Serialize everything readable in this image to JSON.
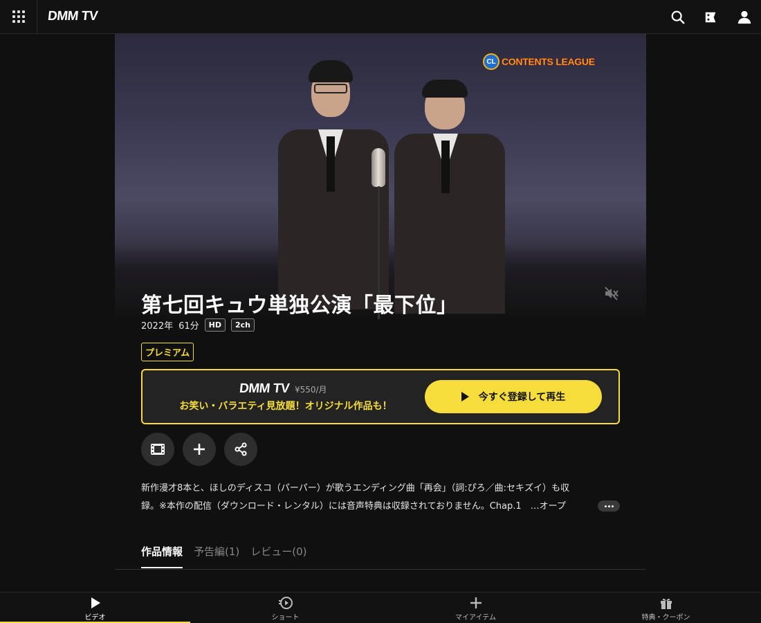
{
  "header": {
    "logo": "DMM TV",
    "icons": [
      "menu-grid-icon",
      "search-icon",
      "ticket-icon",
      "user-icon"
    ]
  },
  "hero": {
    "watermark": "CONTENTS LEAGUE",
    "watermark_badge": "CL"
  },
  "title": {
    "main": "第七回キュウ単独公演「最下位」",
    "year": "2022年",
    "duration": "61分",
    "tags": [
      "HD",
      "2ch"
    ],
    "badge": "プレミアム"
  },
  "promo": {
    "logo": "DMM TV",
    "price": "¥550/月",
    "text": "お笑い・バラエティ見放題！オリジナル作品も！",
    "button_label": "今すぐ登録して再生"
  },
  "description": {
    "line1": "新作漫才8本と、ほしのディスコ（パーパー）が歌うエンディング曲「再会」（詞:ぴろ／曲:セキズイ）も収",
    "line2": "録。※本作の配信（ダウンロード・レンタル）には音声特典は収録されておりません。Chap.1　…オープ"
  },
  "tabs": [
    {
      "label": "作品情報",
      "active": true
    },
    {
      "label": "予告編(1)",
      "active": false
    },
    {
      "label": "レビュー(0)",
      "active": false
    }
  ],
  "bottom_nav": [
    {
      "label": "ビデオ",
      "icon": "play-icon",
      "active": true
    },
    {
      "label": "ショート",
      "icon": "short-icon",
      "active": false
    },
    {
      "label": "マイアイテム",
      "icon": "plus-icon",
      "active": false
    },
    {
      "label": "特典・クーポン",
      "icon": "gift-icon",
      "active": false
    }
  ],
  "colors": {
    "accent": "#f7dd3b",
    "background": "#101010"
  }
}
